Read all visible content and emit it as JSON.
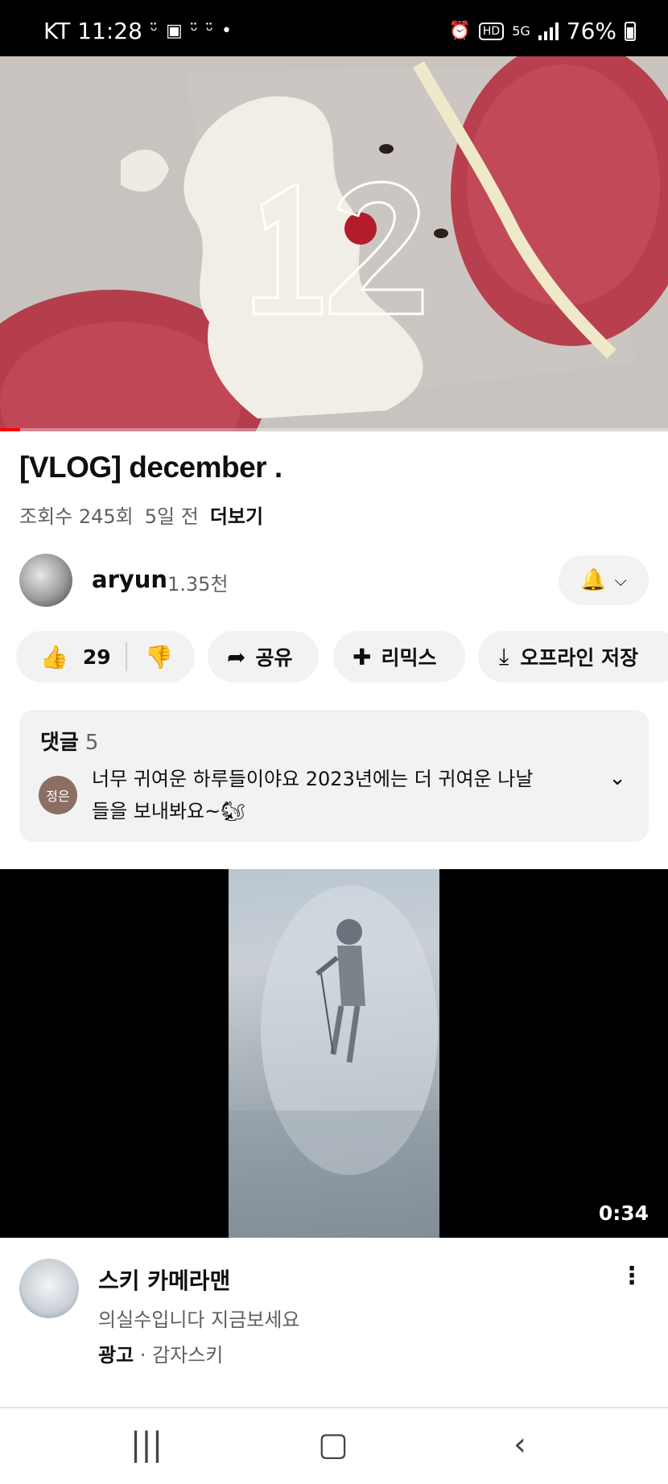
{
  "status_bar": {
    "carrier_time": "KT 11:28",
    "network": "5G",
    "battery": "76%"
  },
  "video": {
    "overlay_number": "12",
    "progress": 0.03
  },
  "meta": {
    "title": "[VLOG] december .",
    "views": "조회수 245회",
    "age": "5일 전",
    "more": "더보기"
  },
  "channel": {
    "name": "aryun",
    "subscribers": "1.35천"
  },
  "actions": {
    "likes": "29",
    "share": "공유",
    "remix": "리믹스",
    "offline": "오프라인 저장"
  },
  "comments": {
    "label": "댓글",
    "count": "5",
    "author_badge": "정은",
    "text": "너무 귀여운 하루들이야요 2023년에는 더 귀여운 나날들을 보내봐요~🐿"
  },
  "ad": {
    "duration": "0:34",
    "title": "스키 카메라맨",
    "description": "의실수입니다 지금보세요",
    "sponsor_label": "광고",
    "sponsor_sep": " · ",
    "sponsor_name": "감자스키"
  }
}
